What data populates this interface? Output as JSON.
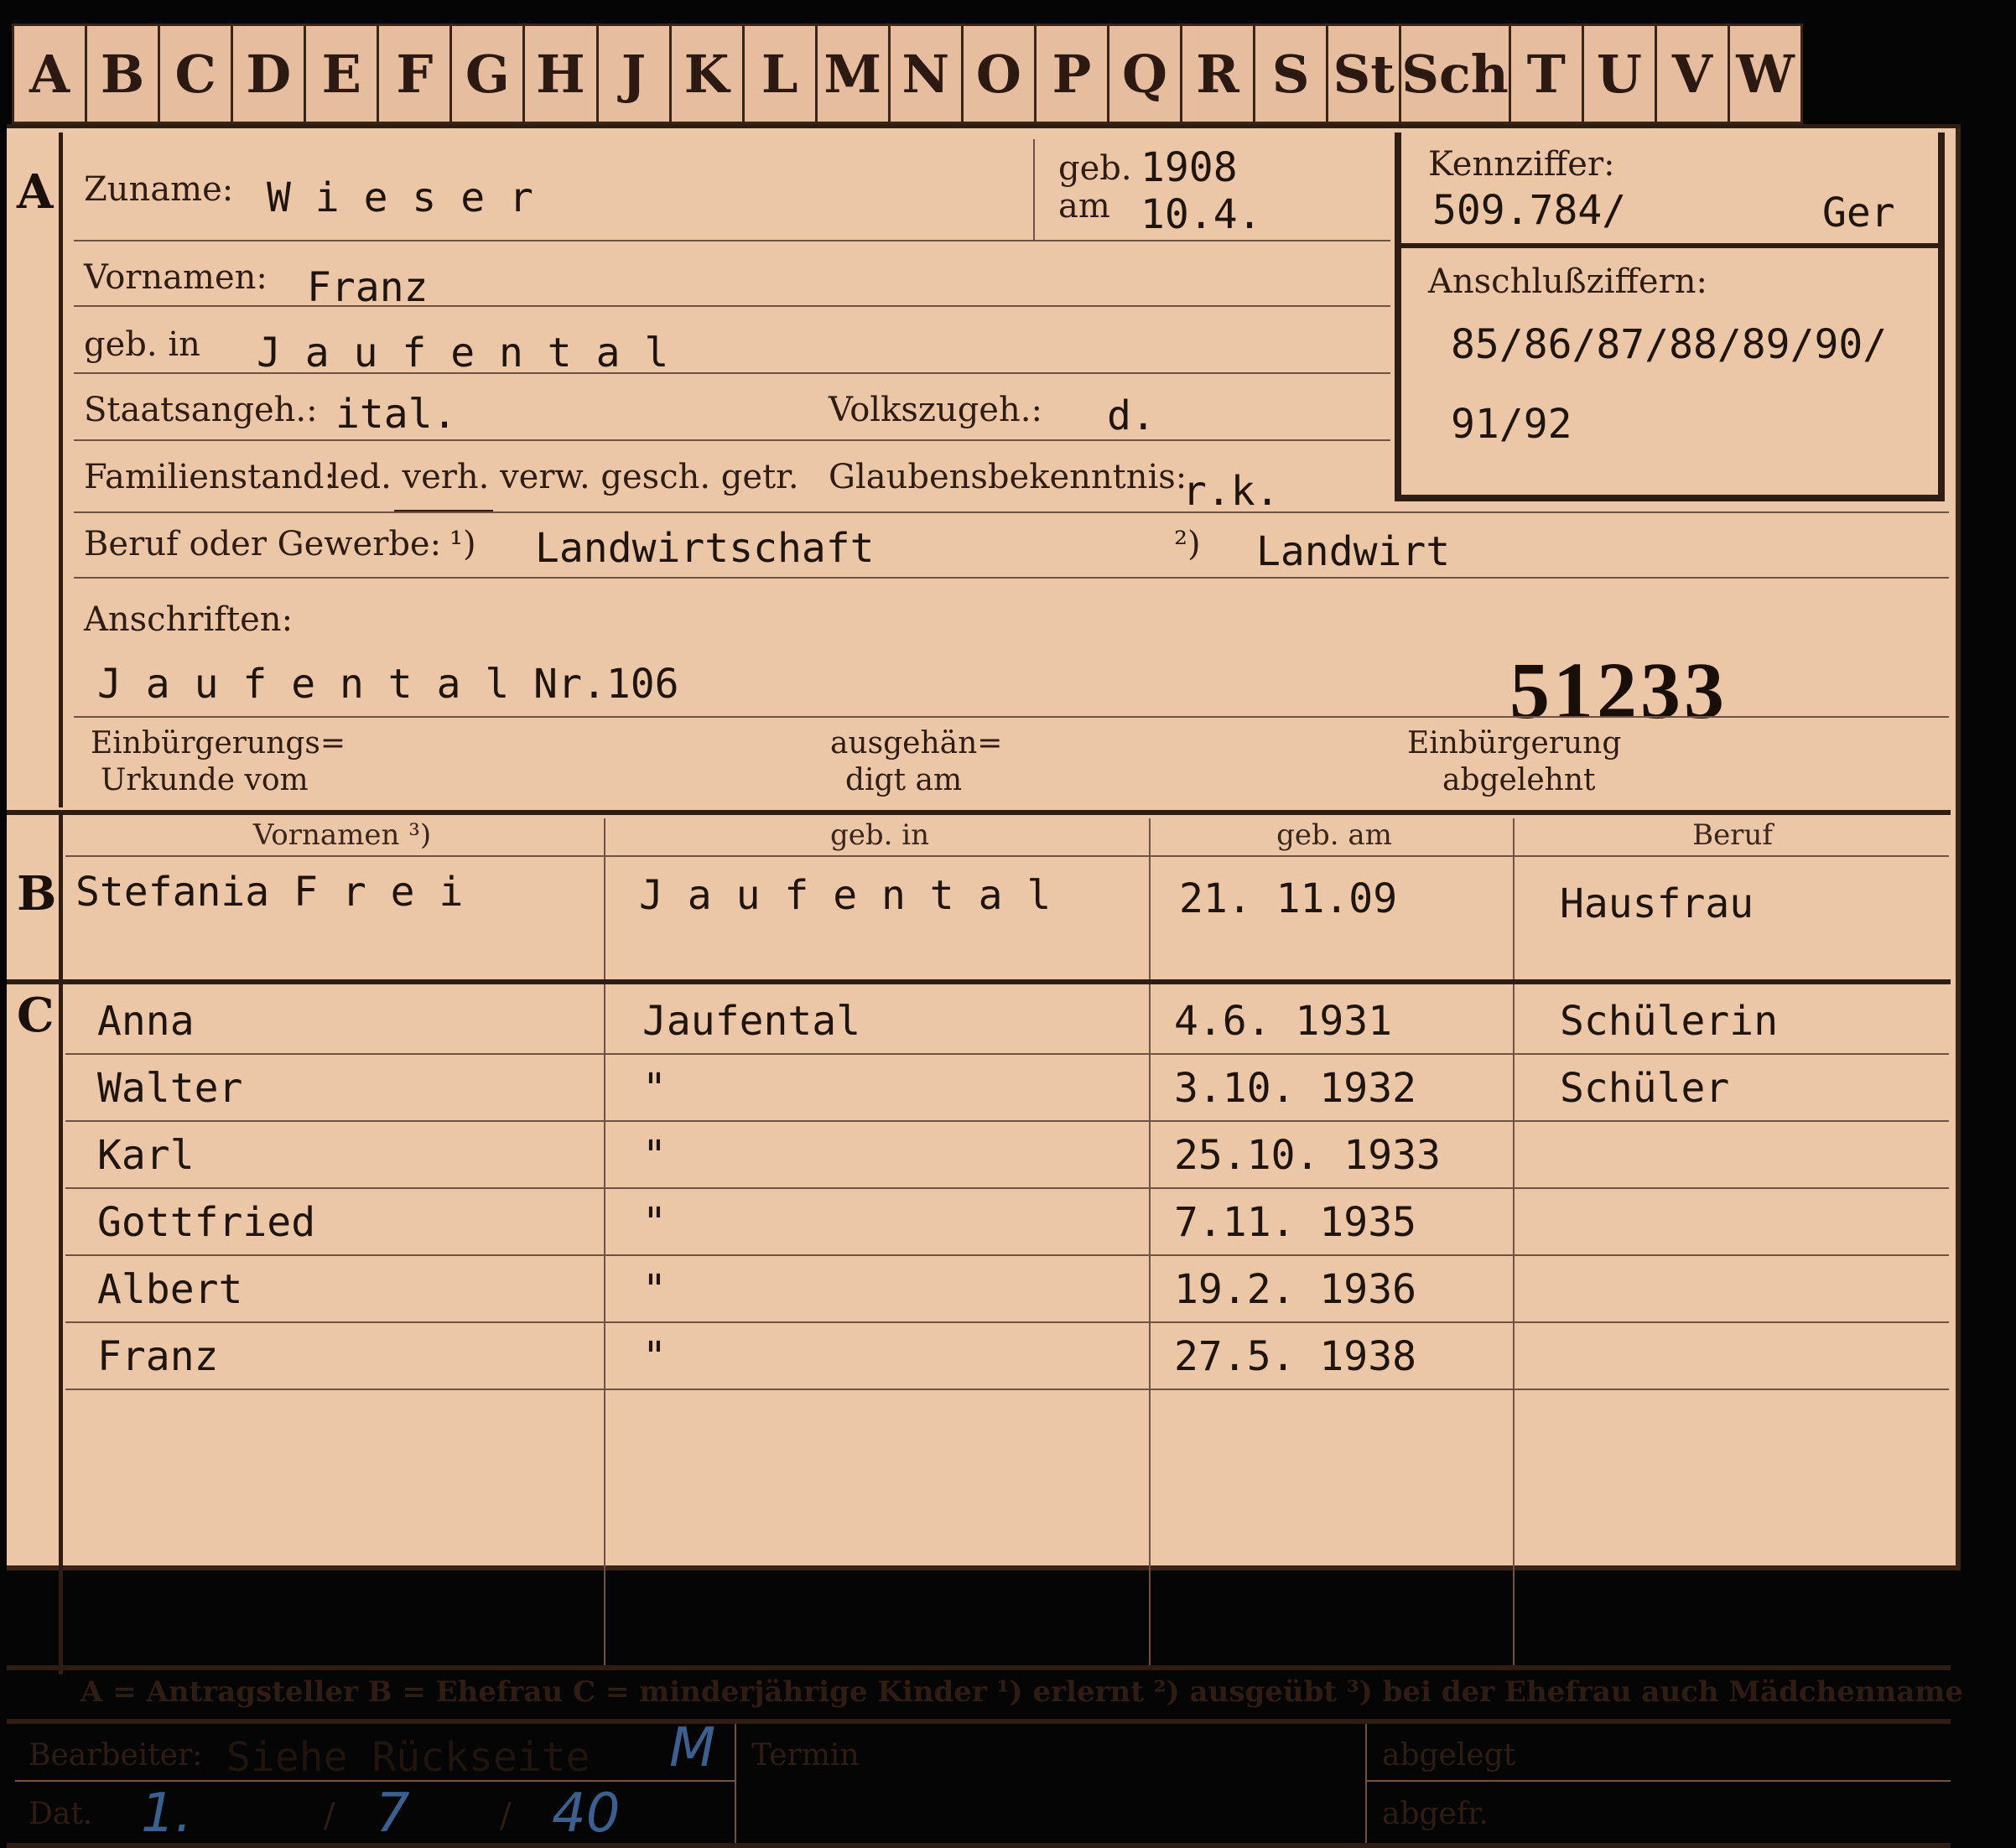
{
  "tabs": [
    "A",
    "B",
    "C",
    "D",
    "E",
    "F",
    "G",
    "H",
    "J",
    "K",
    "L",
    "M",
    "N",
    "O",
    "P",
    "Q",
    "R",
    "S",
    "St",
    "Sch",
    "T",
    "U",
    "V",
    "W"
  ],
  "section_letters": {
    "a": "A",
    "b": "B",
    "c": "C"
  },
  "labels": {
    "zuname": "Zuname:",
    "geb": "geb.",
    "am": "am",
    "kennziffer": "Kennziffer:",
    "vornamen": "Vornamen:",
    "anschlussziffern": "Anschlußziffern:",
    "geb_in": "geb. in",
    "staatsangeh": "Staatsangeh.:",
    "volkszugeh": "Volkszugeh.:",
    "familienstand": "Familienstand:",
    "familienstand_options": "led. verh. verw. gesch. getr.",
    "glaubensbekenntnis": "Glaubensbekenntnis:",
    "beruf": "Beruf oder Gewerbe:",
    "beruf_marker1": "¹)",
    "beruf_marker2": "²)",
    "anschriften": "Anschriften:",
    "einbuergerungs": "Einbürgerungs=",
    "urkunde_vom": "Urkunde vom",
    "ausgehaen": "ausgehän=",
    "digt_am": "digt am",
    "einbuergerung": "Einbürgerung",
    "abgelehnt": "abgelehnt",
    "legend": "A = Antragsteller   B = Ehefrau   C = minderjährige Kinder   ¹) erlernt   ²) ausgeübt   ³) bei der Ehefrau auch Mädchenname",
    "bearbeiter": "Bearbeiter:",
    "dat": "Dat.",
    "termin": "Termin",
    "abgelegt": "abgelegt",
    "abgefr": "abgefr."
  },
  "applicant": {
    "zuname": "W i e s e r",
    "geb_year": "1908",
    "geb_date": "10.4.",
    "kennziffer": "509.784/",
    "kennziffer_suffix": "Ger",
    "vornamen": "Franz",
    "anschlussziffern_line1": "85/86/87/88/89/90/",
    "anschlussziffern_line2": "91/92",
    "geb_in": "J a u f e n t a l",
    "staatsangeh": "ital.",
    "volkszugeh": "d.",
    "glaubensbekenntnis": "r.k.",
    "beruf_erlernt": "Landwirtschaft",
    "beruf_ausgeuebt": "Landwirt",
    "anschrift": "J a u f e n t a l Nr.106",
    "stamp_number": "51233"
  },
  "spouse_columns": [
    "Vornamen ³)",
    "geb. in",
    "geb. am",
    "Beruf"
  ],
  "spouse": {
    "vornamen": "Stefania  F r e i",
    "geb_in": "J a u f e n t a l",
    "geb_am": "21. 11.09",
    "beruf": "Hausfrau"
  },
  "children": [
    {
      "name": "Anna",
      "place": "Jaufental",
      "date": "4.6.  1931",
      "beruf": "Schülerin"
    },
    {
      "name": "Walter",
      "place": "\"",
      "date": "3.10. 1932",
      "beruf": "Schüler"
    },
    {
      "name": "Karl",
      "place": "\"",
      "date": "25.10. 1933",
      "beruf": ""
    },
    {
      "name": "Gottfried",
      "place": "\"",
      "date": "7.11. 1935",
      "beruf": ""
    },
    {
      "name": "Albert",
      "place": "\"",
      "date": "19.2.  1936",
      "beruf": ""
    },
    {
      "name": "Franz",
      "place": "\"",
      "date": "27.5.  1938",
      "beruf": ""
    }
  ],
  "footer": {
    "bearbeiter_value": "Siehe Rückseite",
    "initials": "M",
    "dat_day": "1.",
    "dat_month": "7",
    "dat_year": "40"
  }
}
